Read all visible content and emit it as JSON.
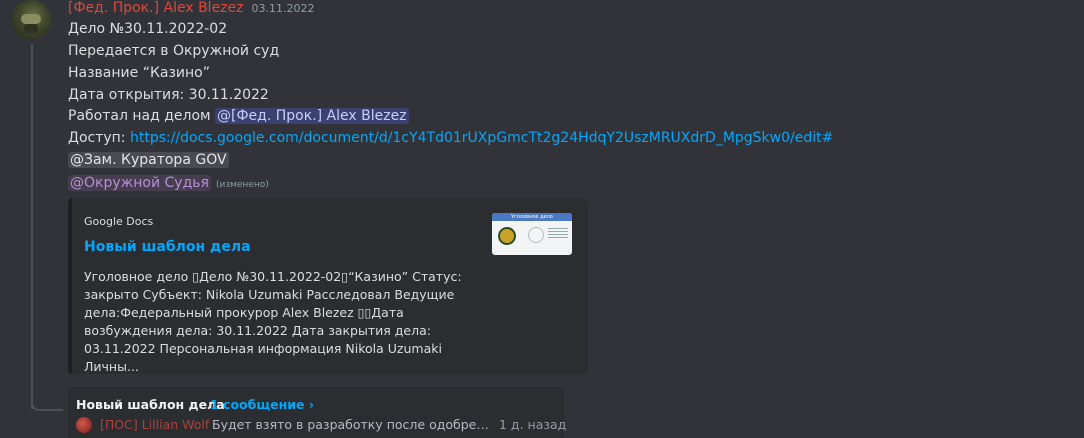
{
  "message": {
    "author": "[Фед. Прок.] Alex Blezez",
    "timestamp": "03.11.2022",
    "line1": "Дело №30.11.2022-02",
    "line2": "Передается в Окружной суд",
    "line3": "Название “Казино”",
    "line4": "Дата открытия: 30.11.2022",
    "line5_prefix": "Работал над делом ",
    "line5_mention": "@[Фед. Прок.] Alex Blezez",
    "line6_prefix": "Доступ: ",
    "line6_link": "https://docs.google.com/document/d/1cY4Td01rUXpGmcTt2g24HdqY2UszMRUXdrD_MpgSkw0/edit#",
    "line7_mention": "@Зам. Куратора GOV",
    "line8_mention": "@Окружной Судья",
    "edited_label": "(изменено)"
  },
  "embed": {
    "provider": "Google Docs",
    "title": "Новый шаблон дела",
    "description": "Уголовное дело ▯Дело №30.11.2022-02▯“Казино” Статус: закрыто Субъект: Nikola Uzumaki Расследовал Ведущие дела:Федеральный прокурор Alex Blezez ▯▯Дата возбуждения дела: 30.11.2022 Дата закрытия дела: 03.11.2022 Персональная информация Nikola Uzumaki Личны...",
    "thumbnail_header": "Уголовное дело"
  },
  "thread": {
    "name": "Новый шаблон дела",
    "count": "1 сообщение ›",
    "last_author": "[ПОС] Lillian Wolf",
    "last_preview": "Будет взято в разработку после одобрения ...",
    "last_time": "1 д. назад"
  },
  "colors": {
    "background": "#313338",
    "author_red": "#e0463c",
    "link_blue": "#00a8fc",
    "mention_bg": "#3c4270",
    "role_purple": "#b68fd6",
    "embed_bg": "#2b2d31"
  },
  "icons": {
    "avatar": "user-avatar-icon",
    "thread_avatar": "thread-reply-avatar-icon"
  }
}
